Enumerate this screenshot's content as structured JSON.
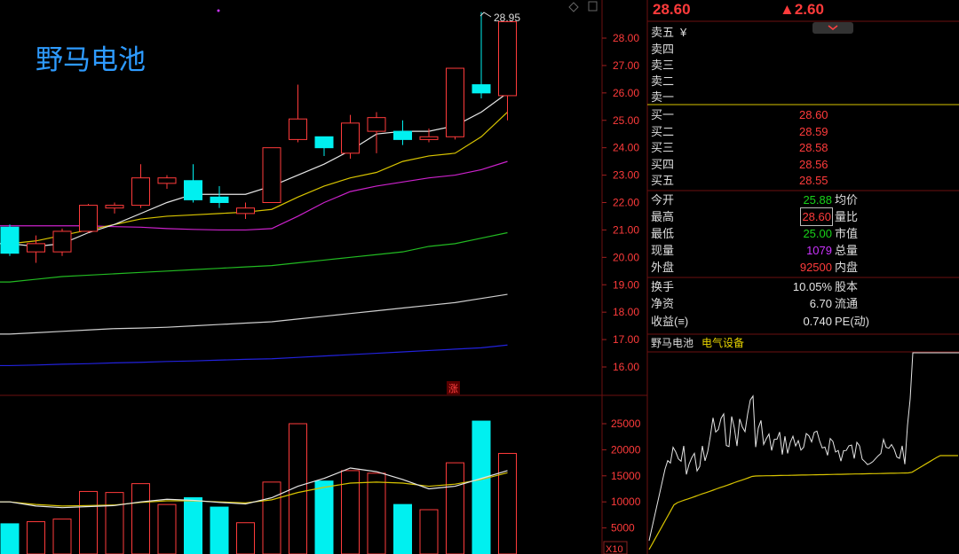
{
  "stock": {
    "name": "野马电池",
    "price": "28.60",
    "change": "▲2.60",
    "industry": "电气设备"
  },
  "main_chart": {
    "price_axis": [
      "28.00",
      "27.00",
      "26.00",
      "25.00",
      "24.00",
      "23.00",
      "22.00",
      "21.00",
      "20.00",
      "19.00",
      "18.00",
      "17.00",
      "16.00"
    ],
    "high_label": "28.95",
    "limit_badge": "涨"
  },
  "volume_chart": {
    "axis": [
      "25000",
      "20000",
      "15000",
      "10000",
      "5000"
    ],
    "unit": "X10"
  },
  "order_book": {
    "sell": [
      {
        "label": "卖五",
        "price": "",
        "vol": "¥"
      },
      {
        "label": "卖四",
        "price": "",
        "vol": ""
      },
      {
        "label": "卖三",
        "price": "",
        "vol": ""
      },
      {
        "label": "卖二",
        "price": "",
        "vol": ""
      },
      {
        "label": "卖一",
        "price": "",
        "vol": ""
      }
    ],
    "buy": [
      {
        "label": "买一",
        "price": "28.60"
      },
      {
        "label": "买二",
        "price": "28.59"
      },
      {
        "label": "买三",
        "price": "28.58"
      },
      {
        "label": "买四",
        "price": "28.56"
      },
      {
        "label": "买五",
        "price": "28.55"
      }
    ]
  },
  "quote_stats": [
    {
      "l1": "今开",
      "v1": "25.88",
      "c1": "green",
      "l2": "均价"
    },
    {
      "l1": "最高",
      "v1": "28.60",
      "c1": "red",
      "l2": "量比",
      "boxed": true
    },
    {
      "l1": "最低",
      "v1": "25.00",
      "c1": "green",
      "l2": "市值"
    },
    {
      "l1": "现量",
      "v1": "1079",
      "c1": "purple",
      "l2": "总量"
    },
    {
      "l1": "外盘",
      "v1": "92500",
      "c1": "red",
      "l2": "内盘"
    }
  ],
  "fundamentals": [
    {
      "l1": "换手",
      "v1": "10.05%",
      "l2": "股本"
    },
    {
      "l1": "净资",
      "v1": "6.70",
      "l2": "流通"
    },
    {
      "l1": "收益(≡)",
      "v1": "0.740",
      "l2": "PE(动)"
    }
  ],
  "chart_data": {
    "type": "candlestick",
    "candles": [
      {
        "o": 21.1,
        "c": 20.15,
        "h": 21.2,
        "l": 20.05
      },
      {
        "o": 20.2,
        "c": 20.5,
        "h": 20.8,
        "l": 19.8
      },
      {
        "o": 20.2,
        "c": 20.95,
        "h": 21.05,
        "l": 20.05
      },
      {
        "o": 20.95,
        "c": 21.9,
        "h": 21.95,
        "l": 20.9
      },
      {
        "o": 21.8,
        "c": 21.9,
        "h": 22.0,
        "l": 21.6
      },
      {
        "o": 21.9,
        "c": 22.9,
        "h": 23.4,
        "l": 21.8
      },
      {
        "o": 22.7,
        "c": 22.9,
        "h": 23.0,
        "l": 22.5
      },
      {
        "o": 22.8,
        "c": 22.1,
        "h": 23.4,
        "l": 22.0
      },
      {
        "o": 22.2,
        "c": 22.0,
        "h": 22.6,
        "l": 21.8
      },
      {
        "o": 21.6,
        "c": 21.8,
        "h": 22.0,
        "l": 21.4
      },
      {
        "o": 22.0,
        "c": 24.0,
        "h": 24.0,
        "l": 22.0
      },
      {
        "o": 24.3,
        "c": 25.05,
        "h": 26.3,
        "l": 24.2
      },
      {
        "o": 24.4,
        "c": 24.0,
        "h": 24.4,
        "l": 23.7
      },
      {
        "o": 23.8,
        "c": 24.9,
        "h": 25.2,
        "l": 23.6
      },
      {
        "o": 24.6,
        "c": 25.1,
        "h": 25.3,
        "l": 23.8
      },
      {
        "o": 24.6,
        "c": 24.3,
        "h": 25.0,
        "l": 24.1
      },
      {
        "o": 24.3,
        "c": 24.4,
        "h": 24.7,
        "l": 24.2
      },
      {
        "o": 24.4,
        "c": 26.9,
        "h": 26.9,
        "l": 24.3
      },
      {
        "o": 26.3,
        "c": 26.0,
        "h": 28.95,
        "l": 25.8
      },
      {
        "o": 25.9,
        "c": 28.6,
        "h": 28.6,
        "l": 25.0
      }
    ],
    "ma5": [
      20.5,
      20.4,
      20.5,
      20.9,
      21.2,
      21.6,
      22.0,
      22.3,
      22.3,
      22.3,
      22.6,
      23.0,
      23.4,
      23.9,
      24.5,
      24.6,
      24.6,
      24.8,
      25.3,
      26.0
    ],
    "ma10": [
      20.5,
      20.6,
      20.8,
      21.0,
      21.2,
      21.4,
      21.5,
      21.55,
      21.6,
      21.65,
      21.75,
      22.2,
      22.6,
      22.9,
      23.1,
      23.5,
      23.7,
      23.8,
      24.4,
      25.3
    ],
    "ma20": [
      21.15,
      21.15,
      21.15,
      21.15,
      21.12,
      21.1,
      21.05,
      21.02,
      21.0,
      21.0,
      21.05,
      21.5,
      22.0,
      22.4,
      22.6,
      22.75,
      22.9,
      23.0,
      23.2,
      23.5
    ],
    "ma30": [
      19.1,
      19.2,
      19.3,
      19.35,
      19.4,
      19.45,
      19.5,
      19.55,
      19.6,
      19.65,
      19.7,
      19.8,
      19.9,
      20.0,
      20.1,
      20.2,
      20.4,
      20.5,
      20.7,
      20.9
    ],
    "ma60": [
      17.2,
      17.25,
      17.3,
      17.35,
      17.4,
      17.42,
      17.45,
      17.5,
      17.55,
      17.6,
      17.65,
      17.75,
      17.85,
      17.95,
      18.05,
      18.15,
      18.25,
      18.35,
      18.5,
      18.65
    ],
    "ma120": [
      16.05,
      16.07,
      16.1,
      16.12,
      16.15,
      16.17,
      16.2,
      16.22,
      16.25,
      16.28,
      16.3,
      16.35,
      16.4,
      16.45,
      16.5,
      16.55,
      16.6,
      16.65,
      16.7,
      16.8
    ],
    "volume": [
      5800,
      6200,
      6700,
      12000,
      11800,
      13500,
      9500,
      10800,
      9000,
      6000,
      13800,
      25000,
      14000,
      16000,
      15500,
      9500,
      8500,
      17500,
      25500,
      19300
    ],
    "vol_ma5": [
      10000,
      9200,
      8900,
      9100,
      9300,
      10000,
      10500,
      10300,
      9900,
      9600,
      10800,
      13000,
      14500,
      16500,
      15800,
      14300,
      12500,
      13000,
      14500,
      16000
    ],
    "vol_ma10": [
      10000,
      9500,
      9200,
      9300,
      9400,
      9900,
      10200,
      10200,
      10000,
      9800,
      10400,
      11800,
      12800,
      13600,
      13800,
      13600,
      13000,
      13400,
      14300,
      15600
    ]
  }
}
